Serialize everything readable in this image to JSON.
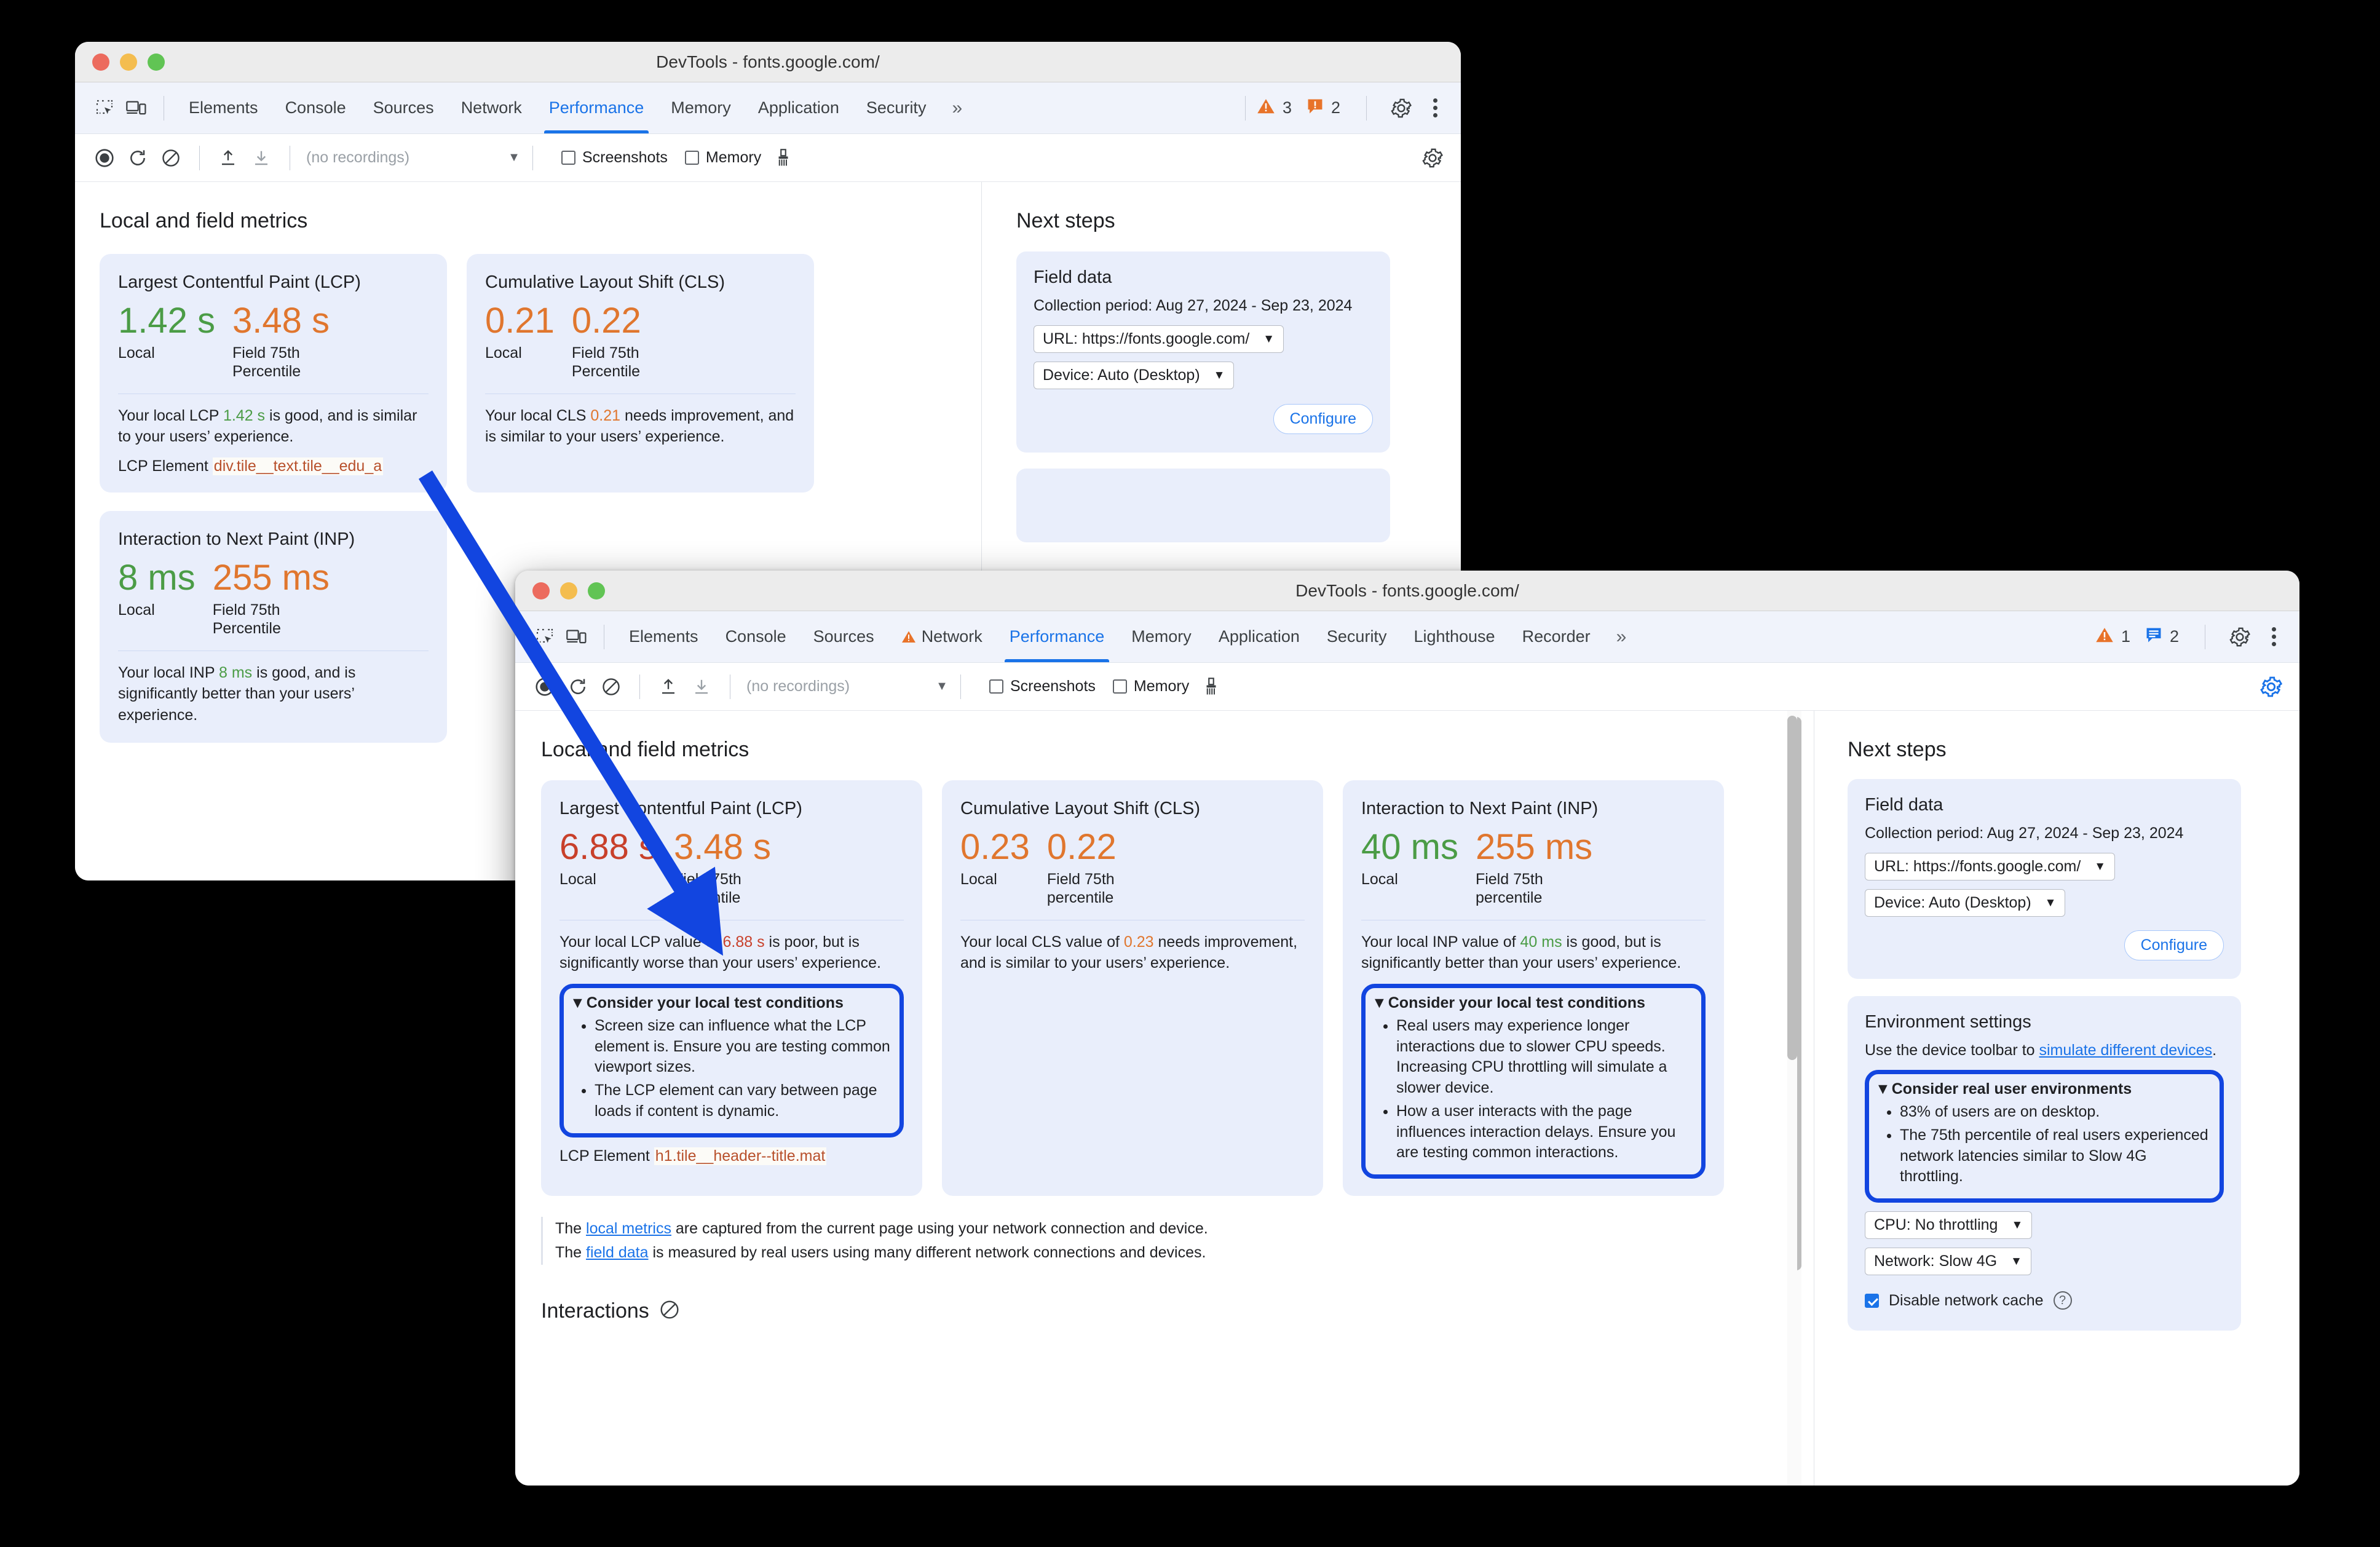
{
  "back_window": {
    "title": "DevTools - fonts.google.com/",
    "tabs": [
      {
        "label": "Elements",
        "active": false,
        "warn": false
      },
      {
        "label": "Console",
        "active": false,
        "warn": false
      },
      {
        "label": "Sources",
        "active": false,
        "warn": false
      },
      {
        "label": "Network",
        "active": false,
        "warn": false
      },
      {
        "label": "Performance",
        "active": true,
        "warn": false
      },
      {
        "label": "Memory",
        "active": false,
        "warn": false
      },
      {
        "label": "Application",
        "active": false,
        "warn": false
      },
      {
        "label": "Security",
        "active": false,
        "warn": false
      }
    ],
    "overflow_label": "»",
    "warning_count": "3",
    "issue_count": "2",
    "toolbar": {
      "recordings_placeholder": "(no recordings)",
      "screenshots_label": "Screenshots",
      "memory_label": "Memory"
    },
    "main": {
      "section_title": "Local and field metrics",
      "cards": [
        {
          "title": "Largest Contentful Paint (LCP)",
          "local_value": "1.42 s",
          "local_status": "good",
          "local_label": "Local",
          "field_value": "3.48 s",
          "field_status": "ni",
          "field_label": "Field 75th Percentile",
          "summary_pre": "Your local LCP ",
          "summary_val": "1.42 s",
          "summary_post": " is good, and is similar to your users’ experience.",
          "lcp_element_label": "LCP Element",
          "lcp_element_value": "div.tile__text.tile__edu_a"
        },
        {
          "title": "Cumulative Layout Shift (CLS)",
          "local_value": "0.21",
          "local_status": "ni",
          "local_label": "Local",
          "field_value": "0.22",
          "field_status": "ni",
          "field_label": "Field 75th Percentile",
          "summary_pre": "Your local CLS ",
          "summary_val": "0.21",
          "summary_post": " needs improvement, and is similar to your users’ experience."
        },
        {
          "title": "Interaction to Next Paint (INP)",
          "local_value": "8 ms",
          "local_status": "good",
          "local_label": "Local",
          "field_value": "255 ms",
          "field_status": "ni",
          "field_label": "Field 75th Percentile",
          "summary_pre": "Your local INP ",
          "summary_val": "8 ms",
          "summary_post": " is good, and is significantly better than your users’ experience."
        }
      ]
    },
    "side": {
      "title": "Next steps",
      "field_data": {
        "heading": "Field data",
        "collection_period": "Collection period: Aug 27, 2024 - Sep 23, 2024",
        "url_select": "URL: https://fonts.google.com/",
        "device_select": "Device: Auto (Desktop)",
        "configure_label": "Configure"
      }
    }
  },
  "front_window": {
    "title": "DevTools - fonts.google.com/",
    "tabs": [
      {
        "label": "Elements",
        "active": false,
        "warn": false
      },
      {
        "label": "Console",
        "active": false,
        "warn": false
      },
      {
        "label": "Sources",
        "active": false,
        "warn": false
      },
      {
        "label": "Network",
        "active": false,
        "warn": true
      },
      {
        "label": "Performance",
        "active": true,
        "warn": false
      },
      {
        "label": "Memory",
        "active": false,
        "warn": false
      },
      {
        "label": "Application",
        "active": false,
        "warn": false
      },
      {
        "label": "Security",
        "active": false,
        "warn": false
      },
      {
        "label": "Lighthouse",
        "active": false,
        "warn": false
      },
      {
        "label": "Recorder",
        "active": false,
        "warn": false
      }
    ],
    "overflow_label": "»",
    "warning_count": "1",
    "issue_count": "2",
    "toolbar": {
      "recordings_placeholder": "(no recordings)",
      "screenshots_label": "Screenshots",
      "memory_label": "Memory"
    },
    "main": {
      "section_title": "Local and field metrics",
      "cards": [
        {
          "title": "Largest Contentful Paint (LCP)",
          "local_value": "6.88 s",
          "local_status": "poor",
          "local_label": "Local",
          "field_value": "3.48 s",
          "field_status": "ni",
          "field_label": "Field 75th percentile",
          "summary_pre": "Your local LCP value of ",
          "summary_val": "6.88 s",
          "summary_post": " is poor, but is significantly worse than your users’ experience.",
          "insight": {
            "header": "Consider your local test conditions",
            "bullets": [
              "Screen size can influence what the LCP element is. Ensure you are testing common viewport sizes.",
              "The LCP element can vary between page loads if content is dynamic."
            ],
            "highlighted": true
          },
          "lcp_element_label": "LCP Element",
          "lcp_element_value": "h1.tile__header--title.mat"
        },
        {
          "title": "Cumulative Layout Shift (CLS)",
          "local_value": "0.23",
          "local_status": "ni",
          "local_label": "Local",
          "field_value": "0.22",
          "field_status": "ni",
          "field_label": "Field 75th percentile",
          "summary_pre": "Your local CLS value of ",
          "summary_val": "0.23",
          "summary_post": " needs improvement, and is similar to your users’ experience."
        },
        {
          "title": "Interaction to Next Paint (INP)",
          "local_value": "40 ms",
          "local_status": "good",
          "local_label": "Local",
          "field_value": "255 ms",
          "field_status": "ni",
          "field_label": "Field 75th percentile",
          "summary_pre": "Your local INP value of ",
          "summary_val": "40 ms",
          "summary_post": " is good, but is significantly better than your users’ experience.",
          "insight": {
            "header": "Consider your local test conditions",
            "bullets": [
              "Real users may experience longer interactions due to slower CPU speeds. Increasing CPU throttling will simulate a slower device.",
              "How a user interacts with the page influences interaction delays. Ensure you are testing common interactions."
            ],
            "highlighted": true
          }
        }
      ],
      "footnotes": [
        {
          "pre": "The ",
          "link": "local metrics",
          "post": " are captured from the current page using your network connection and device."
        },
        {
          "pre": "The ",
          "link": "field data",
          "post": " is measured by real users using many different network connections and devices."
        }
      ],
      "interactions_title": "Interactions"
    },
    "side": {
      "title": "Next steps",
      "field_data": {
        "heading": "Field data",
        "collection_period": "Collection period: Aug 27, 2024 - Sep 23, 2024",
        "url_select": "URL: https://fonts.google.com/",
        "device_select": "Device: Auto (Desktop)",
        "configure_label": "Configure"
      },
      "environment": {
        "heading": "Environment settings",
        "intro_pre": "Use the device toolbar to ",
        "intro_link": "simulate different devices",
        "intro_post": ".",
        "insight": {
          "header": "Consider real user environments",
          "bullets": [
            "83% of users are on desktop.",
            "The 75th percentile of real users experienced network latencies similar to Slow 4G throttling."
          ],
          "highlighted": true
        },
        "cpu_select": "CPU: No throttling",
        "network_select": "Network: Slow 4G",
        "disable_cache_label": "Disable network cache",
        "help_glyph": "?"
      }
    }
  },
  "annotation": {
    "arrow_color": "#1245e0",
    "highlight_color": "#1245e0"
  }
}
